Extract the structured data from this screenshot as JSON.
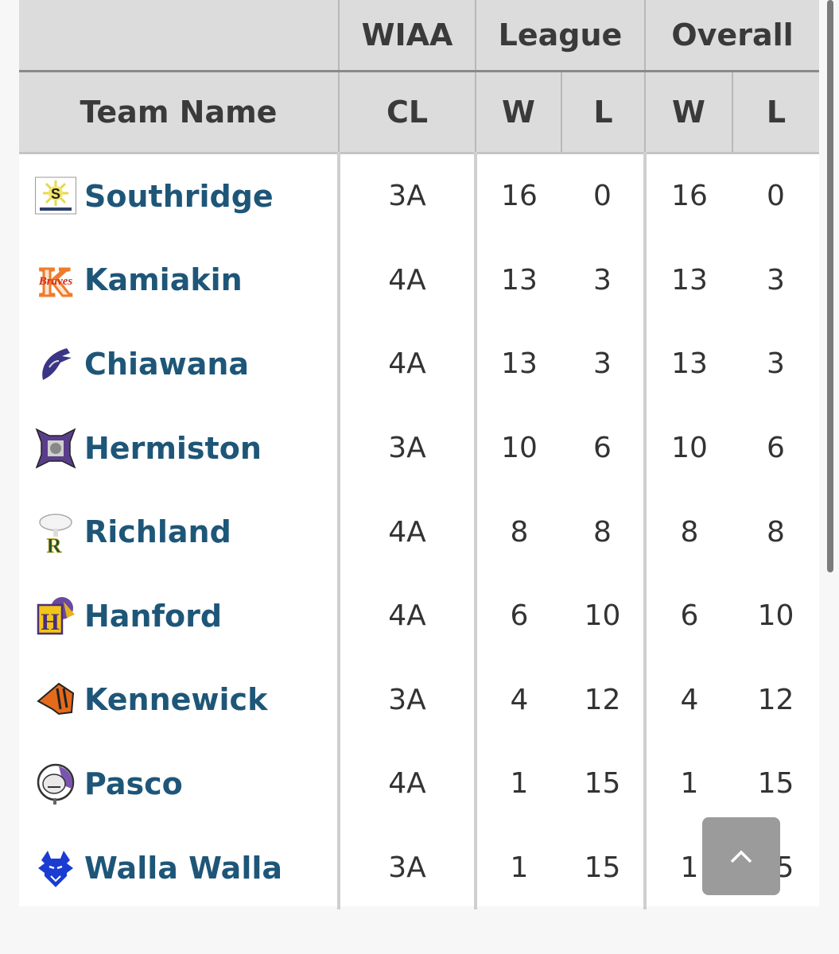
{
  "table": {
    "group_headers": {
      "team": "",
      "wiaa": "WIAA",
      "league": "League",
      "overall": "Overall"
    },
    "sub_headers": {
      "team": "Team Name",
      "cl": "CL",
      "league_w": "W",
      "league_l": "L",
      "overall_w": "W",
      "overall_l": "L"
    },
    "rows": [
      {
        "team": "Southridge",
        "logo": "southridge-sun-logo",
        "cl": "3A",
        "league_w": "16",
        "league_l": "0",
        "overall_w": "16",
        "overall_l": "0"
      },
      {
        "team": "Kamiakin",
        "logo": "kamiakin-braves-logo",
        "cl": "4A",
        "league_w": "13",
        "league_l": "3",
        "overall_w": "13",
        "overall_l": "3"
      },
      {
        "team": "Chiawana",
        "logo": "chiawana-riverhawk-logo",
        "cl": "4A",
        "league_w": "13",
        "league_l": "3",
        "overall_w": "13",
        "overall_l": "3"
      },
      {
        "team": "Hermiston",
        "logo": "hermiston-bulldog-logo",
        "cl": "3A",
        "league_w": "10",
        "league_l": "6",
        "overall_w": "10",
        "overall_l": "6"
      },
      {
        "team": "Richland",
        "logo": "richland-bomber-logo",
        "cl": "4A",
        "league_w": "8",
        "league_l": "8",
        "overall_w": "8",
        "overall_l": "8"
      },
      {
        "team": "Hanford",
        "logo": "hanford-falcon-logo",
        "cl": "4A",
        "league_w": "6",
        "league_l": "10",
        "overall_w": "6",
        "overall_l": "10"
      },
      {
        "team": "Kennewick",
        "logo": "kennewick-lion-logo",
        "cl": "3A",
        "league_w": "4",
        "league_l": "12",
        "overall_w": "4",
        "overall_l": "12"
      },
      {
        "team": "Pasco",
        "logo": "pasco-bulldog-logo",
        "cl": "4A",
        "league_w": "1",
        "league_l": "15",
        "overall_w": "1",
        "overall_l": "15"
      },
      {
        "team": "Walla Walla",
        "logo": "walla-walla-bluedevil-logo",
        "cl": "3A",
        "league_w": "1",
        "league_l": "15",
        "overall_w": "1",
        "overall_l": "15"
      }
    ]
  },
  "colors": {
    "team_link": "#1e5678",
    "header_bg": "#dcdcdc",
    "header_text": "#3a3a3a"
  },
  "controls": {
    "scroll_to_top_icon": "chevron-up-icon"
  }
}
